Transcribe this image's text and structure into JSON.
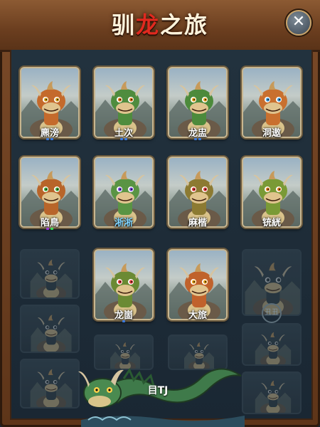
{
  "title": {
    "left": "驯",
    "accent": "龙",
    "right": "之旅"
  },
  "colors": {
    "frame": "#6b3e1f",
    "panel": "#1f2d39",
    "title_accent": "#e0291f",
    "card_border": "#c8b690"
  },
  "dragons": [
    {
      "name": "麃滂",
      "skin": "#c46a2c",
      "eye": "#d8a21a",
      "tint": "orange",
      "dots": [
        "#3a7adf",
        "#3a7adf"
      ]
    },
    {
      "name": "土次",
      "skin": "#4f8c3e",
      "eye": "#e07a1f",
      "tint": "green",
      "dots": [
        "#3a7adf",
        "#3a7adf"
      ]
    },
    {
      "name": "龙盅",
      "skin": "#4c8a3b",
      "eye": "#e6a01a",
      "tint": "green",
      "dots": [
        "#3a7adf",
        "#3a7adf"
      ]
    },
    {
      "name": "洞遨",
      "skin": "#c9702f",
      "eye": "#3a9adf",
      "tint": "orange",
      "dots": []
    },
    {
      "name": "陷鳥",
      "skin": "#b8652a",
      "eye": "#3faa3a",
      "tint": "orange",
      "dots": [
        "#9b3adf",
        "#3adf5a"
      ]
    },
    {
      "name": "淅淅",
      "skin": "#5a9444",
      "eye": "#7a4adf",
      "tint": "green",
      "name_color": "blue",
      "dots": []
    },
    {
      "name": "麻楷",
      "skin": "#8c7a32",
      "eye": "#df3a3a",
      "tint": "olive",
      "dots": []
    },
    {
      "name": "铳絖",
      "skin": "#7a9a36",
      "eye": "#df7a1f",
      "tint": "olive",
      "dots": []
    },
    {
      "name": "龙崮",
      "skin": "#6b8a34",
      "eye": "#df3a3a",
      "tint": "olive",
      "dots": [
        "#3a7adf"
      ]
    },
    {
      "name": "大旅",
      "skin": "#c0622c",
      "eye": "#e6a01a",
      "tint": "orange",
      "dots": []
    }
  ],
  "locked_slot_mark": "丑丑",
  "serpent": {
    "label": "目TJ"
  }
}
